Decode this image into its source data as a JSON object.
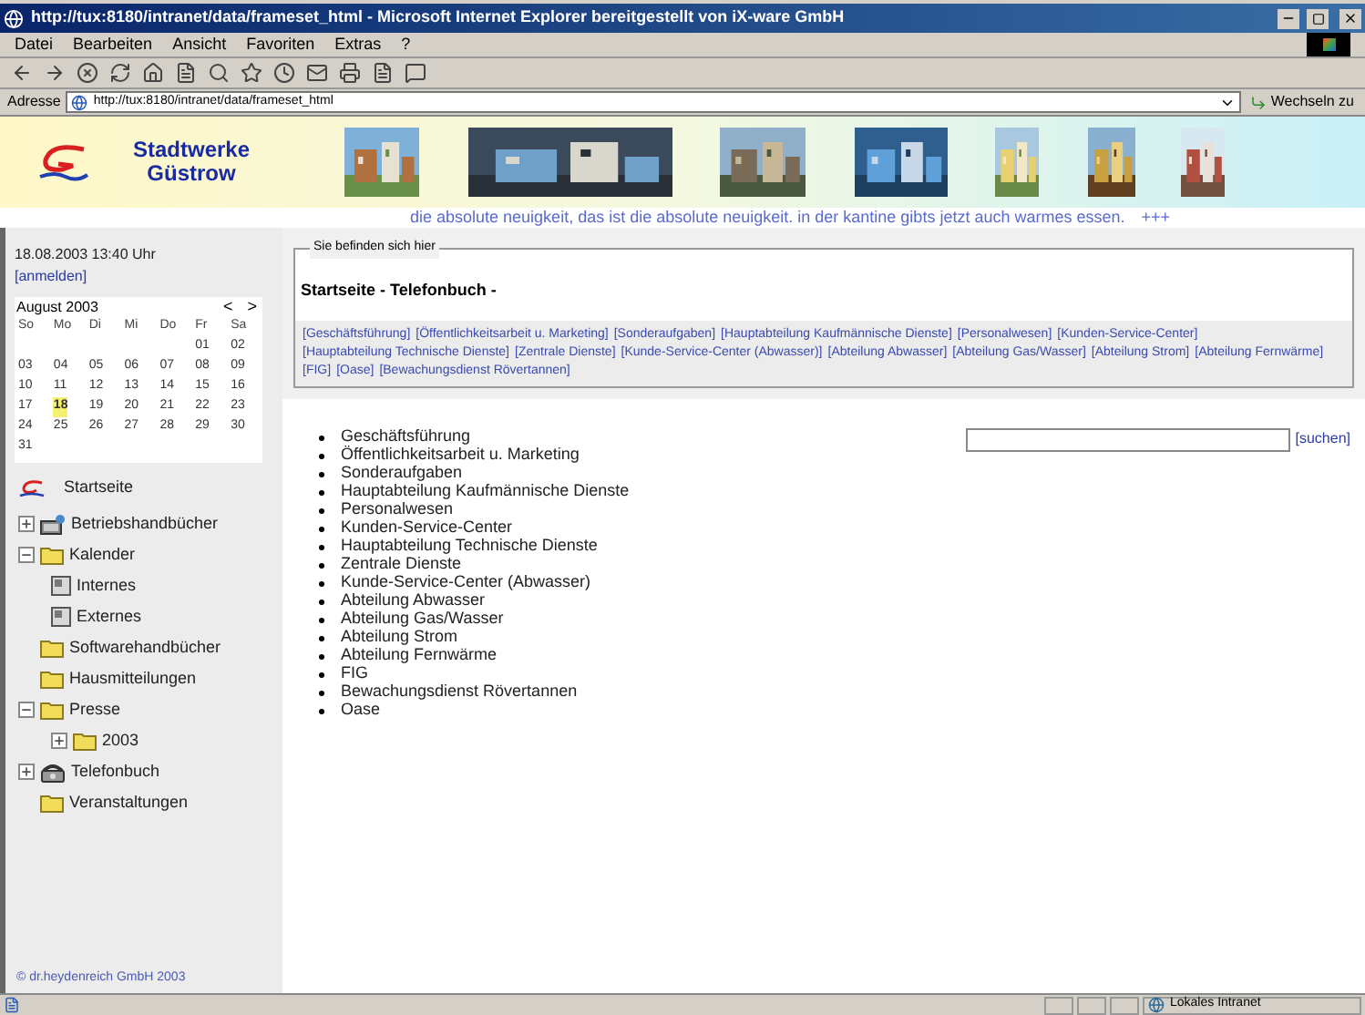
{
  "window": {
    "title": "http://tux:8180/intranet/data/frameset_html - Microsoft Internet Explorer bereitgestellt von iX-ware GmbH"
  },
  "menu": [
    "Datei",
    "Bearbeiten",
    "Ansicht",
    "Favoriten",
    "Extras",
    "?"
  ],
  "address": {
    "label": "Adresse",
    "value": "http://tux:8180/intranet/data/frameset_html",
    "go_button": "Wechseln zu"
  },
  "banner": {
    "logo_line1": "Stadtwerke",
    "logo_line2": "Güstrow",
    "ticker": "die absolute neuigkeit, das ist die absolute neuigkeit. in der kantine gibts jetzt auch warmes essen.",
    "ticker_mark": "+++"
  },
  "sidebar": {
    "datetime": "18.08.2003 13:40 Uhr",
    "login": "[anmelden]",
    "calendar": {
      "month": "August 2003",
      "prev": "<",
      "next": ">",
      "weekdays": [
        "So",
        "Mo",
        "Di",
        "Mi",
        "Do",
        "Fr",
        "Sa"
      ],
      "weeks": [
        [
          {
            "day": "01",
            "selected": false
          },
          {
            "day": "02",
            "selected": false
          }
        ],
        [
          {
            "day": "03",
            "selected": false
          },
          {
            "day": "04",
            "selected": false
          },
          {
            "day": "05",
            "selected": false
          },
          {
            "day": "06",
            "selected": false
          },
          {
            "day": "07",
            "selected": false
          },
          {
            "day": "08",
            "selected": false
          },
          {
            "day": "09",
            "selected": false
          }
        ],
        [
          {
            "day": "10",
            "selected": false
          },
          {
            "day": "11",
            "selected": false
          },
          {
            "day": "12",
            "selected": false
          },
          {
            "day": "13",
            "selected": false
          },
          {
            "day": "14",
            "selected": false
          },
          {
            "day": "15",
            "selected": false
          },
          {
            "day": "16",
            "selected": false
          }
        ],
        [
          {
            "day": "17",
            "selected": false
          },
          {
            "day": "18",
            "selected": true
          },
          {
            "day": "19",
            "selected": false
          },
          {
            "day": "20",
            "selected": false
          },
          {
            "day": "21",
            "selected": false
          },
          {
            "day": "22",
            "selected": false
          },
          {
            "day": "23",
            "selected": false
          }
        ],
        [
          {
            "day": "24",
            "selected": false
          },
          {
            "day": "25",
            "selected": false
          },
          {
            "day": "26",
            "selected": false
          },
          {
            "day": "27",
            "selected": false
          },
          {
            "day": "28",
            "selected": false
          },
          {
            "day": "29",
            "selected": false
          },
          {
            "day": "30",
            "selected": false
          }
        ],
        [
          {
            "day": "31",
            "selected": false
          }
        ]
      ]
    },
    "home": "Startseite",
    "tree": [
      {
        "label": "Betriebshandbücher",
        "kind": "book",
        "expanded": false
      },
      {
        "label": "Kalender",
        "kind": "folder",
        "expanded": true,
        "children": [
          {
            "label": "Internes",
            "kind": "page"
          },
          {
            "label": "Externes",
            "kind": "page"
          }
        ]
      },
      {
        "label": "Softwarehandbücher",
        "kind": "folder"
      },
      {
        "label": "Hausmitteilungen",
        "kind": "folder"
      },
      {
        "label": "Presse",
        "kind": "folder",
        "expanded": true,
        "children": [
          {
            "label": "2003",
            "kind": "folder",
            "expanded": false
          }
        ]
      },
      {
        "label": "Telefonbuch",
        "kind": "phone",
        "expanded": false
      },
      {
        "label": "Veranstaltungen",
        "kind": "folder"
      }
    ],
    "footer": "© dr.heydenreich GmbH 2003"
  },
  "breadcrumb": {
    "legend": "Sie befinden sich hier",
    "title": "Startseite - Telefonbuch -",
    "links": [
      "[Geschäftsführung]",
      "[Öffentlichkeitsarbeit u. Marketing]",
      "[Sonderaufgaben]",
      "[Hauptabteilung Kaufmännische Dienste]",
      "[Personalwesen]",
      "[Kunden-Service-Center]",
      "[Hauptabteilung Technische Dienste]",
      "[Zentrale Dienste]",
      "[Kunde-Service-Center (Abwasser)]",
      "[Abteilung Abwasser]",
      "[Abteilung Gas/Wasser]",
      "[Abteilung Strom]",
      "[Abteilung Fernwärme]",
      "[FIG]",
      "[Oase]",
      "[Bewachungsdienst Rövertannen]"
    ]
  },
  "list": [
    "Geschäftsführung",
    "Öffentlichkeitsarbeit u. Marketing",
    "Sonderaufgaben",
    "Hauptabteilung Kaufmännische Dienste",
    "Personalwesen",
    "Kunden-Service-Center",
    "Hauptabteilung Technische Dienste",
    "Zentrale Dienste",
    "Kunde-Service-Center (Abwasser)",
    "Abteilung Abwasser",
    "Abteilung Gas/Wasser",
    "Abteilung Strom",
    "Abteilung Fernwärme",
    "FIG",
    "Bewachungsdienst Rövertannen",
    "Oase"
  ],
  "search": {
    "button": "[suchen]"
  },
  "status_bar": {
    "zone": "Lokales Intranet"
  }
}
